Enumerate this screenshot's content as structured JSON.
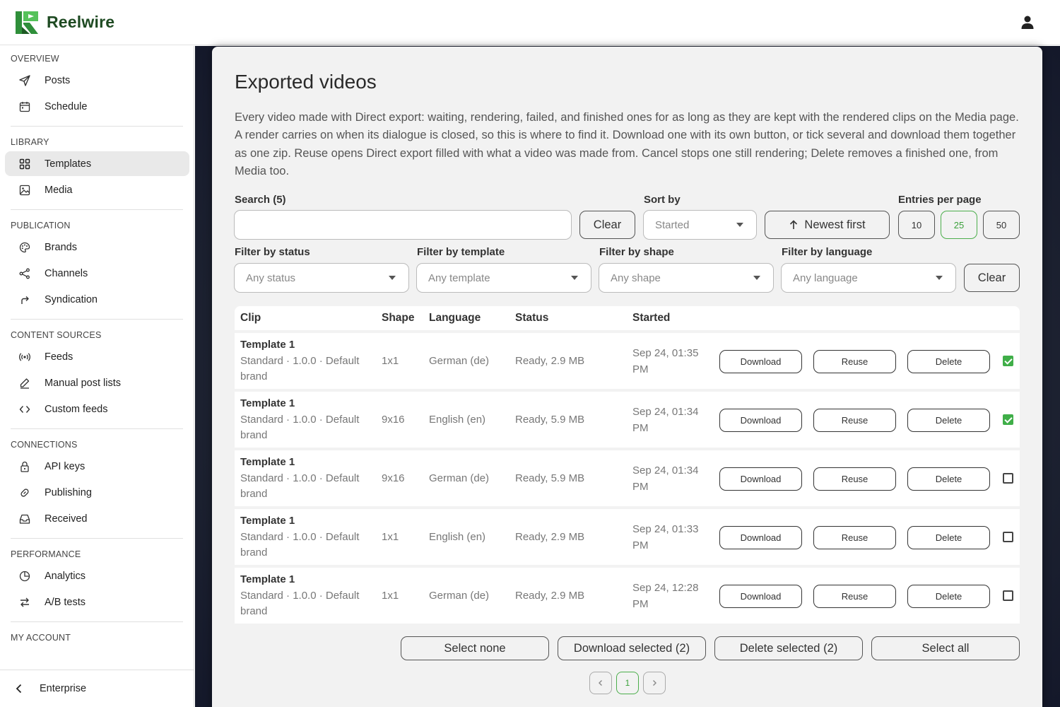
{
  "app": {
    "name": "Reelwire",
    "logo_colors": [
      "#2f8f3a",
      "#55c25a",
      "#1e5a24"
    ]
  },
  "header": {
    "account_icon": "person-icon"
  },
  "sidebar": {
    "sections": [
      {
        "title": "OVERVIEW",
        "items": [
          {
            "label": "Posts",
            "icon": "send-icon"
          },
          {
            "label": "Schedule",
            "icon": "calendar-icon"
          }
        ]
      },
      {
        "title": "LIBRARY",
        "items": [
          {
            "label": "Templates",
            "icon": "grid-icon",
            "active": true
          },
          {
            "label": "Media",
            "icon": "image-icon"
          }
        ]
      },
      {
        "title": "PUBLICATION",
        "items": [
          {
            "label": "Brands",
            "icon": "palette-icon"
          },
          {
            "label": "Channels",
            "icon": "share-icon"
          },
          {
            "label": "Syndication",
            "icon": "forward-icon"
          }
        ]
      },
      {
        "title": "CONTENT SOURCES",
        "items": [
          {
            "label": "Feeds",
            "icon": "broadcast-icon"
          },
          {
            "label": "Manual post lists",
            "icon": "pencil-icon"
          },
          {
            "label": "Custom feeds",
            "icon": "code-icon"
          }
        ]
      },
      {
        "title": "CONNECTIONS",
        "items": [
          {
            "label": "API keys",
            "icon": "lock-icon"
          },
          {
            "label": "Publishing",
            "icon": "link-icon"
          },
          {
            "label": "Received",
            "icon": "inbox-icon"
          }
        ]
      },
      {
        "title": "PERFORMANCE",
        "items": [
          {
            "label": "Analytics",
            "icon": "pie-chart-icon"
          },
          {
            "label": "A/B tests",
            "icon": "swap-icon"
          }
        ]
      },
      {
        "title": "MY ACCOUNT",
        "items": []
      }
    ],
    "footer": {
      "label": "Enterprise",
      "icon": "chevron-left-icon"
    }
  },
  "page": {
    "title": "Exported videos",
    "description": "Every video made with Direct export: waiting, rendering, failed, and finished ones for as long as they are kept with the rendered clips on the Media page. A render carries on when its dialogue is closed, so this is where to find it. Download one with its own button, or tick several and download them together as one zip. Reuse opens Direct export filled with what a video was made from. Cancel stops one still rendering; Delete removes a finished one, from Media too."
  },
  "search": {
    "label": "Search (5)",
    "value": "",
    "placeholder": "",
    "clear_label": "Clear"
  },
  "sort": {
    "label": "Sort by",
    "value": "Started",
    "direction_label": "Newest first"
  },
  "entries": {
    "label": "Entries per page",
    "options": [
      "10",
      "25",
      "50"
    ],
    "selected": "25"
  },
  "filters": {
    "status": {
      "label": "Filter by status",
      "value": "Any status"
    },
    "template": {
      "label": "Filter by template",
      "value": "Any template"
    },
    "shape": {
      "label": "Filter by shape",
      "value": "Any shape"
    },
    "language": {
      "label": "Filter by language",
      "value": "Any language"
    },
    "clear_label": "Clear"
  },
  "table": {
    "columns": [
      "Clip",
      "Shape",
      "Language",
      "Status",
      "Started"
    ],
    "actions": {
      "download": "Download",
      "reuse": "Reuse",
      "delete": "Delete"
    },
    "rows": [
      {
        "title": "Template 1",
        "sub1": "Standard · 1.0.0 · Default",
        "sub2": "brand",
        "shape": "1x1",
        "language": "German (de)",
        "status": "Ready, 2.9 MB",
        "started1": "Sep 24, 01:35",
        "started2": "PM",
        "checked": true
      },
      {
        "title": "Template 1",
        "sub1": "Standard · 1.0.0 · Default",
        "sub2": "brand",
        "shape": "9x16",
        "language": "English (en)",
        "status": "Ready, 5.9 MB",
        "started1": "Sep 24, 01:34",
        "started2": "PM",
        "checked": true
      },
      {
        "title": "Template 1",
        "sub1": "Standard · 1.0.0 · Default",
        "sub2": "brand",
        "shape": "9x16",
        "language": "German (de)",
        "status": "Ready, 5.9 MB",
        "started1": "Sep 24, 01:34",
        "started2": "PM",
        "checked": false
      },
      {
        "title": "Template 1",
        "sub1": "Standard · 1.0.0 · Default",
        "sub2": "brand",
        "shape": "1x1",
        "language": "English (en)",
        "status": "Ready, 2.9 MB",
        "started1": "Sep 24, 01:33",
        "started2": "PM",
        "checked": false
      },
      {
        "title": "Template 1",
        "sub1": "Standard · 1.0.0 · Default",
        "sub2": "brand",
        "shape": "1x1",
        "language": "German (de)",
        "status": "Ready, 2.9 MB",
        "started1": "Sep 24, 12:28",
        "started2": "PM",
        "checked": false
      }
    ]
  },
  "bulk": {
    "select_none": "Select none",
    "download_selected": "Download selected (2)",
    "delete_selected": "Delete selected (2)",
    "select_all": "Select all"
  },
  "pagination": {
    "current": "1"
  }
}
